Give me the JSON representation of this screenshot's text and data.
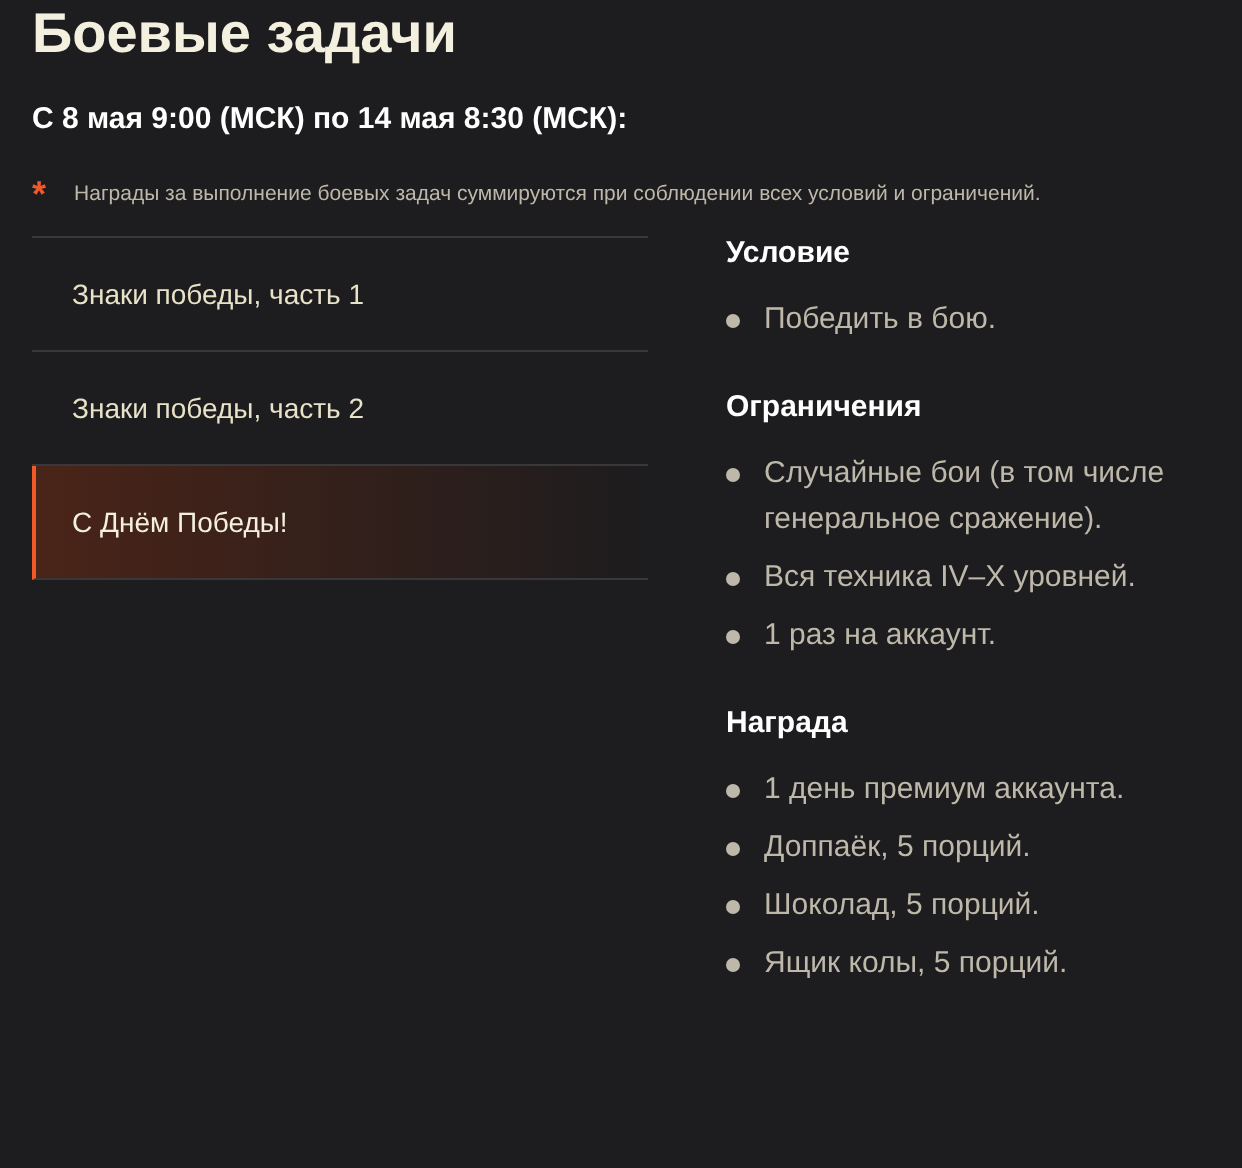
{
  "title": "Боевые задачи",
  "period": "С 8 мая 9:00 (МСК) по 14 мая 8:30 (МСК):",
  "note": {
    "mark": "*",
    "text": "Награды за выполнение боевых задач суммируются при соблюдении всех условий и ограничений."
  },
  "tasks": [
    {
      "label": "Знаки победы, часть 1",
      "selected": false
    },
    {
      "label": "Знаки победы, часть 2",
      "selected": false
    },
    {
      "label": "С Днём Победы!",
      "selected": true
    }
  ],
  "sections": [
    {
      "title": "Условие",
      "items": [
        "Победить в бою."
      ]
    },
    {
      "title": "Ограничения",
      "items": [
        "Случайные бои (в том числе генеральное сражение).",
        "Вся техника IV–X уровней.",
        "1 раз на аккаунт."
      ]
    },
    {
      "title": "Награда",
      "items": [
        "1 день премиум аккаунта.",
        "Доппаёк, 5 порций.",
        "Шоколад, 5 порций.",
        "Ящик колы, 5 порций."
      ]
    }
  ]
}
